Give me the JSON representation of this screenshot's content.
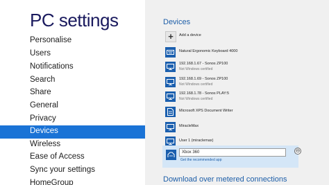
{
  "sidebar": {
    "title": "PC settings",
    "items": [
      {
        "label": "Personalise"
      },
      {
        "label": "Users"
      },
      {
        "label": "Notifications"
      },
      {
        "label": "Search"
      },
      {
        "label": "Share"
      },
      {
        "label": "General"
      },
      {
        "label": "Privacy"
      },
      {
        "label": "Devices",
        "selected": true
      },
      {
        "label": "Wireless"
      },
      {
        "label": "Ease of Access"
      },
      {
        "label": "Sync your settings"
      },
      {
        "label": "HomeGroup"
      }
    ]
  },
  "main": {
    "section_title": "Devices",
    "add_device": {
      "label": "Add a device",
      "icon": "plus-icon"
    },
    "devices": [
      {
        "name": "Natural Ergonomic Keyboard 4000",
        "status": "",
        "icon": "keyboard-icon"
      },
      {
        "name": "192.168.1.67 - Sonos ZP100",
        "status": "Not Windows certified",
        "icon": "media-device-icon"
      },
      {
        "name": "192.168.1.69 - Sonos ZP100",
        "status": "Not Windows certified",
        "icon": "media-device-icon"
      },
      {
        "name": "192.168.1.78 - Sonos PLAY:5",
        "status": "Not Windows certified",
        "icon": "media-device-icon"
      },
      {
        "name": "Microsoft XPS Document Writer",
        "status": "",
        "icon": "printer-icon"
      },
      {
        "name": "MiracleMax",
        "status": "",
        "icon": "computer-icon"
      },
      {
        "name": "User 1 (miraclemax)",
        "status": "",
        "icon": "computer-icon"
      }
    ],
    "selected_device": {
      "name_value": "Xbox 360",
      "link": "Get the recommended app",
      "remove_symbol": "⊖"
    },
    "bottom_section_title": "Download over metered connections"
  },
  "colors": {
    "accent": "#1a73d6",
    "title": "#1a1a5e",
    "section": "#1d5ea8",
    "device_icon_bg": "#1b5fae",
    "panel_bg": "#f0f0f0",
    "selected_device_bg": "#d4e6f7"
  }
}
